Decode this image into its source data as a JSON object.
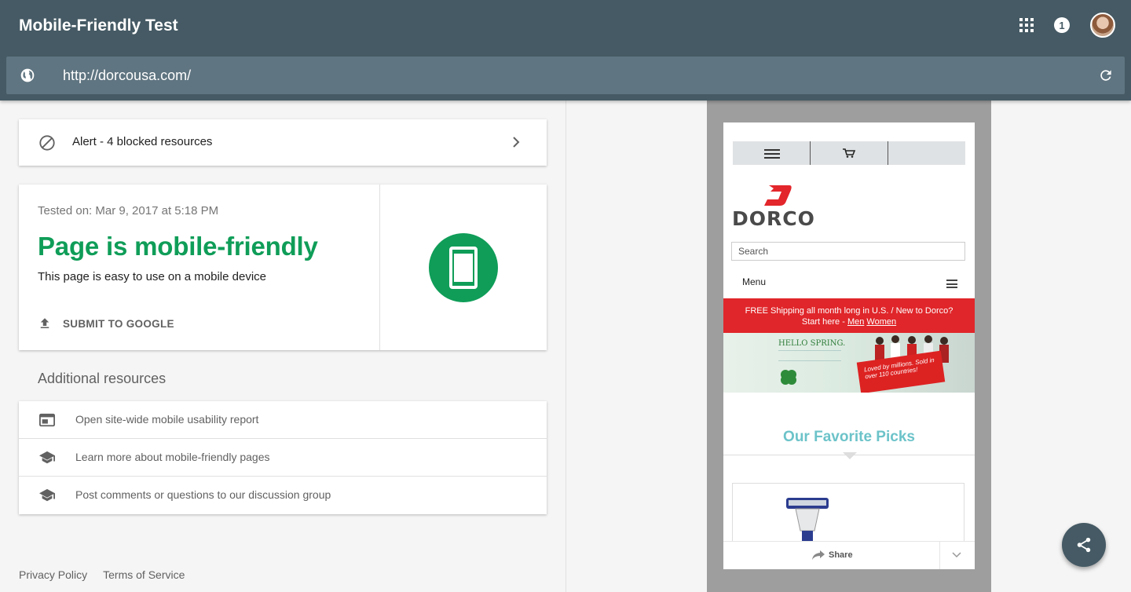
{
  "app": {
    "title": "Mobile-Friendly Test",
    "notification_count": "1"
  },
  "url_bar": {
    "url": "http://dorcousa.com/"
  },
  "alert": {
    "text": "Alert - 4 blocked resources"
  },
  "result": {
    "tested_on": "Tested on: Mar 9, 2017 at 5:18 PM",
    "headline": "Page is mobile-friendly",
    "subline": "This page is easy to use on a mobile device",
    "submit_label": "SUBMIT TO GOOGLE",
    "status_color": "#0f9d58"
  },
  "additional": {
    "title": "Additional resources",
    "items": [
      {
        "label": "Open site-wide mobile usability report",
        "icon": "report-icon"
      },
      {
        "label": "Learn more about mobile-friendly pages",
        "icon": "school-icon"
      },
      {
        "label": "Post comments or questions to our discussion group",
        "icon": "school-icon"
      }
    ]
  },
  "footer": {
    "privacy": "Privacy Policy",
    "terms": "Terms of Service"
  },
  "preview": {
    "brand": "DORCO",
    "search_placeholder": "Search",
    "menu_label": "Menu",
    "promo_line1": "FREE Shipping all month long in U.S.   /    New to Dorco?",
    "promo_line2_prefix": "Start here  -",
    "promo_men": "Men",
    "promo_women": "Women",
    "banner_hello": "HELLO SPRING.",
    "banner_sign": "Loved by millions. Sold in over 110 countries!",
    "section_title": "Our Favorite Picks",
    "share_label": "Share"
  },
  "colors": {
    "header": "#455a64",
    "url_bar": "#5f7581",
    "promo_red": "#e0262a",
    "fav_title": "#6cc3c9"
  }
}
